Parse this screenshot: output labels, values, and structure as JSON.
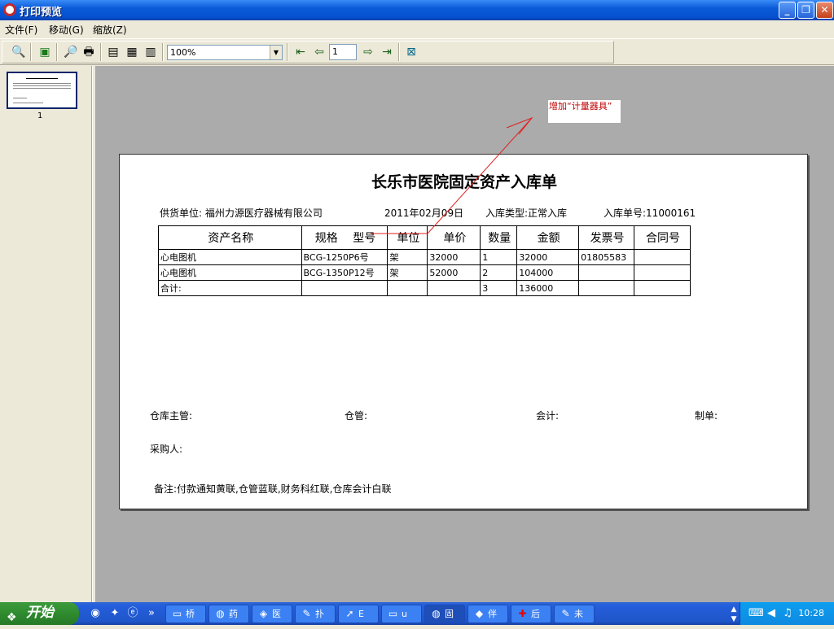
{
  "window": {
    "title": "打印预览"
  },
  "menu": [
    {
      "label": "文件(F)"
    },
    {
      "label": "移动(G)"
    },
    {
      "label": "缩放(Z)"
    }
  ],
  "toolbar": {
    "zoom_value": "100%",
    "page_value": "1"
  },
  "thumbnail": {
    "page_label": "1"
  },
  "document": {
    "title": "长乐市医院固定资产入库单",
    "supplier": "供货单位: 福州力源医疗器械有限公司",
    "date": "2011年02月09日",
    "stock_type": "入库类型:正常入库",
    "doc_no": "入库单号:11000161",
    "headers": [
      "资产名称",
      "规格　 型号",
      "单位",
      "单价",
      "数量",
      "金额",
      "发票号",
      "合同号"
    ],
    "rows": [
      [
        "心电图机",
        "BCG-1250P6号",
        "架",
        "32000",
        "1",
        "32000",
        "01805583",
        ""
      ],
      [
        "心电图机",
        "BCG-1350P12号",
        "架",
        "52000",
        "2",
        "104000",
        "",
        ""
      ],
      [
        "合计:",
        "",
        "",
        "",
        "3",
        "136000",
        "",
        ""
      ]
    ],
    "sign_manager": "仓库主管:",
    "sign_keeper": "仓管:",
    "sign_accountant": "会计:",
    "sign_maker": "制单:",
    "sign_buyer": "采购人:",
    "remark": "备注:付款通知黄联,仓管蓝联,财务科红联,仓库会计白联"
  },
  "annotation": {
    "text": "增加“计量器具”"
  },
  "taskbar": {
    "start_label": "开始",
    "tasks": [
      {
        "label": "桥"
      },
      {
        "label": "药"
      },
      {
        "label": "医"
      },
      {
        "label": "扑"
      },
      {
        "label": "E"
      },
      {
        "label": "u"
      },
      {
        "label": "固"
      },
      {
        "label": "伴"
      },
      {
        "label": "后"
      },
      {
        "label": "未"
      }
    ],
    "clock": "10:28"
  }
}
